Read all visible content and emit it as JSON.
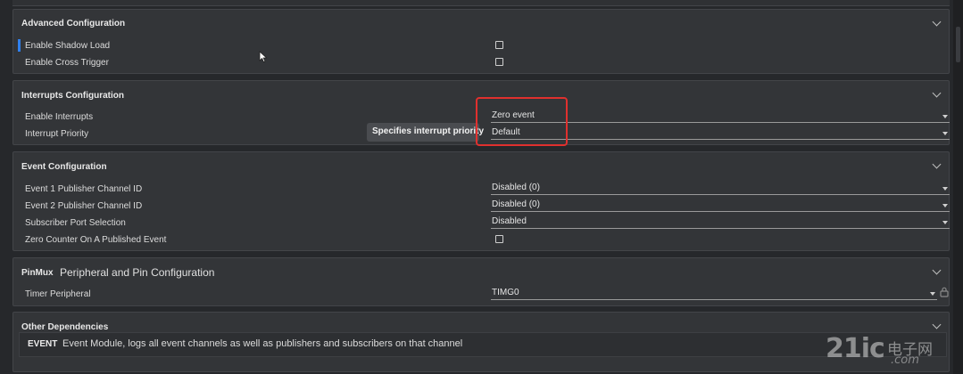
{
  "advanced": {
    "title": "Advanced Configuration",
    "enable_shadow_load": "Enable Shadow Load",
    "enable_cross_trigger": "Enable Cross Trigger"
  },
  "interrupts": {
    "title": "Interrupts Configuration",
    "enable_interrupts_label": "Enable Interrupts",
    "enable_interrupts_value": "Zero event",
    "priority_label": "Interrupt Priority",
    "priority_value": "Default",
    "tooltip": "Specifies interrupt priority"
  },
  "event": {
    "title": "Event Configuration",
    "ev1_label": "Event 1 Publisher Channel ID",
    "ev1_value": "Disabled (0)",
    "ev2_label": "Event 2 Publisher Channel ID",
    "ev2_value": "Disabled (0)",
    "sub_label": "Subscriber Port Selection",
    "sub_value": "Disabled",
    "zero_counter_label": "Zero Counter On A Published Event"
  },
  "pinmux": {
    "tag": "PinMux",
    "title": "Peripheral and Pin Configuration",
    "timer_label": "Timer Peripheral",
    "timer_value": "TIMG0"
  },
  "dependencies": {
    "title": "Other Dependencies",
    "tag": "EVENT",
    "text": "Event Module, logs all event channels as well as publishers and subscribers on that channel"
  },
  "watermark": {
    "brand": "21ic",
    "cn": "电子网",
    "com": ".com"
  },
  "colors": {
    "highlight": "#e0302e",
    "focus": "#2f80ed"
  }
}
